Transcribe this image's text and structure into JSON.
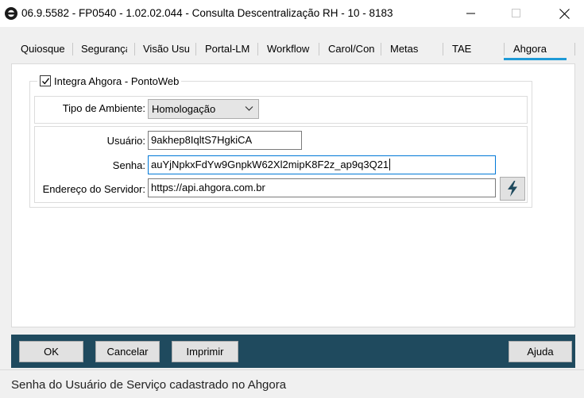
{
  "window": {
    "title": "06.9.5582 - FP0540 - 1.02.02.044 - Consulta Descentralização RH - 10 - 8183",
    "icon": "totvs-logo-icon"
  },
  "tabs": [
    {
      "label": "Quiosque"
    },
    {
      "label": "Segurança"
    },
    {
      "label": "Visão Usuário"
    },
    {
      "label": "Portal-LM"
    },
    {
      "label": "Workflow"
    },
    {
      "label": "Carol/Conector"
    },
    {
      "label": "Metas"
    },
    {
      "label": "TAE"
    },
    {
      "label": "Ahgora"
    }
  ],
  "active_tab": "Ahgora",
  "group": {
    "label": "Integra Ahgora - PontoWeb",
    "checked": true
  },
  "form": {
    "ambiente_label": "Tipo de Ambiente:",
    "ambiente_value": "Homologação",
    "usuario_label": "Usuário:",
    "usuario_value": "9akhep8IqltS7HgkiCA",
    "senha_label": "Senha:",
    "senha_value": "auYjNpkxFdYw9GnpkW62Xl2mipK8F2z_ap9q3Q21",
    "servidor_label": "Endereço do Servidor:",
    "servidor_value": "https://api.ahgora.com.br"
  },
  "buttons": {
    "ok": "OK",
    "cancelar": "Cancelar",
    "imprimir": "Imprimir",
    "ajuda": "Ajuda"
  },
  "status": {
    "text": "Senha do Usuário de Serviço cadastrado no Ahgora"
  },
  "colors": {
    "accent": "#1e9ad6",
    "bottom_bar": "#1f4a5e",
    "focus": "#0078d7"
  }
}
